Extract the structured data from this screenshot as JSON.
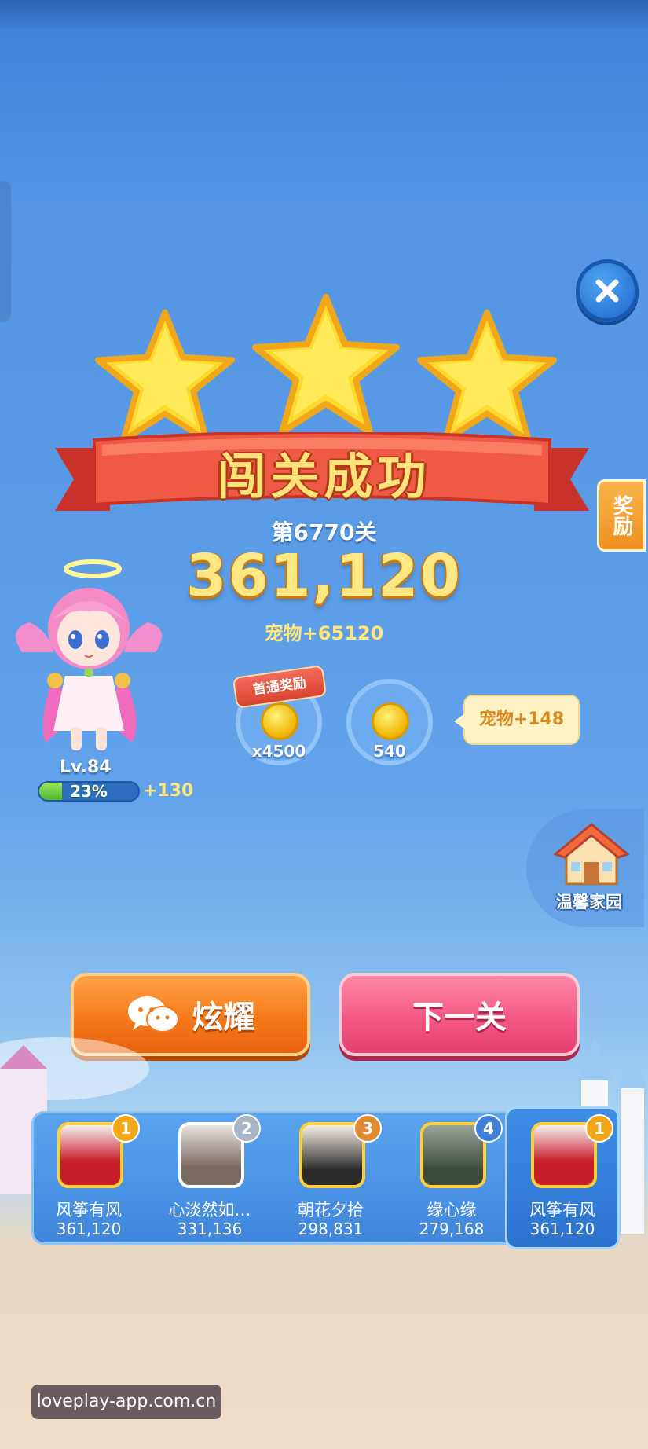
{
  "result": {
    "title": "闯关成功",
    "level_label": "第6770关",
    "score": "361,120",
    "pet_bonus": "宠物+65120",
    "stars_earned": 3
  },
  "character": {
    "level": "Lv.84",
    "exp_percent": "23%",
    "exp_fraction": 0.23,
    "exp_gain": "+130"
  },
  "rewards": [
    {
      "tag": "首通奖励",
      "icon": "coin-icon",
      "amount": "x4500"
    },
    {
      "tag": "",
      "icon": "coin-icon",
      "amount": "540"
    }
  ],
  "pet_reward": "宠物+148",
  "side": {
    "reward_tab": "奖励",
    "home_label": "温馨家园"
  },
  "buttons": {
    "share": "炫耀",
    "next": "下一关"
  },
  "leaderboard": [
    {
      "rank": "1",
      "name": "风筝有风",
      "score": "361,120"
    },
    {
      "rank": "2",
      "name": "心淡然如…",
      "score": "331,136"
    },
    {
      "rank": "3",
      "name": "朝花夕拾",
      "score": "298,831"
    },
    {
      "rank": "4",
      "name": "缘心缘",
      "score": "279,168"
    }
  ],
  "self_entry": {
    "rank": "1",
    "name": "风筝有风",
    "score": "361,120"
  },
  "watermark": "loveplay-app.com.cn",
  "colors": {
    "gold": "#ffe37a",
    "banner_red": "#e8483a",
    "share_orange": "#f57a1a",
    "next_pink": "#f45883",
    "rank1": "#f2a816",
    "rank2": "#a9b4c4",
    "rank3": "#e08a32",
    "rank4": "#3f7fd8"
  }
}
